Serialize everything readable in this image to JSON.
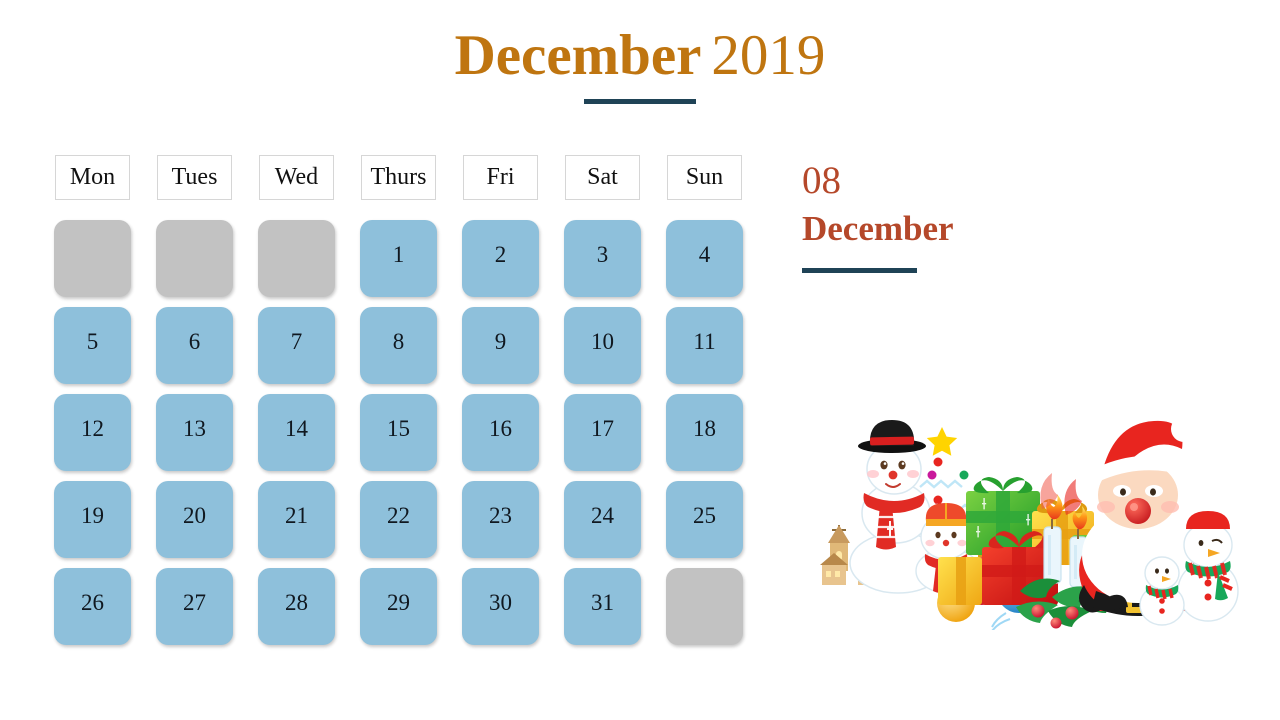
{
  "title": {
    "month": "December",
    "year": "2019",
    "accent_color": "#BF7510",
    "rule_color": "#1F4356"
  },
  "calendar": {
    "weekdays": [
      "Mon",
      "Tues",
      "Wed",
      "Thurs",
      "Fri",
      "Sat",
      "Sun"
    ],
    "active_color": "#8EC0DB",
    "blank_color": "#C2C2C2",
    "number_color": "#101820",
    "weeks": [
      [
        "",
        "",
        "",
        "1",
        "2",
        "3",
        "4"
      ],
      [
        "5",
        "6",
        "7",
        "8",
        "9",
        "10",
        "11"
      ],
      [
        "12",
        "13",
        "14",
        "15",
        "16",
        "17",
        "18"
      ],
      [
        "19",
        "20",
        "21",
        "22",
        "23",
        "24",
        "25"
      ],
      [
        "26",
        "27",
        "28",
        "29",
        "30",
        "31",
        ""
      ]
    ]
  },
  "side_panel": {
    "day_number": "08",
    "month_name": "December",
    "accent_color": "#B5482A",
    "rule_color": "#1F4356"
  },
  "illustration": {
    "name": "christmas-scene",
    "elements": [
      "snowman-large",
      "snowman-small",
      "santa-claus",
      "gift-boxes",
      "christmas-ornaments",
      "candles",
      "holly-branch",
      "church-houses",
      "star"
    ]
  }
}
